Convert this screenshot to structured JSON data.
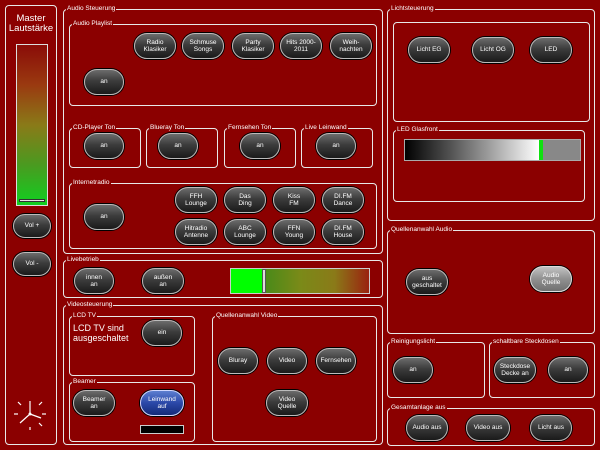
{
  "master": {
    "title": "Master\nLautstärke",
    "vol_plus": "Vol +",
    "vol_minus": "Vol -",
    "level_percent": 3
  },
  "audio": {
    "title": "Audio Steuerung",
    "playlist": {
      "title": "Audio Playlist",
      "on": "an",
      "items": [
        "Radio\nKlasiker",
        "Schmuse\nSongs",
        "Party\nKlasiker",
        "Hits 2000-\n2011",
        "Weih-\nnachten"
      ]
    },
    "cd": {
      "title": "CD-Player Ton",
      "on": "an"
    },
    "bluray": {
      "title": "Blueray Ton",
      "on": "an"
    },
    "fernsehen": {
      "title": "Fernsehen Ton",
      "on": "an"
    },
    "leinwand": {
      "title": "Live Leinwand",
      "on": "an"
    },
    "internetradio": {
      "title": "Internetradio",
      "on": "an",
      "stations": [
        "FFH\nLounge",
        "Das\nDing",
        "Kiss\nFM",
        "DI.FM\nDance",
        "Hitradio\nAntenne",
        "ABC\nLounge",
        "FFN\nYoung",
        "DI.FM\nHouse"
      ]
    }
  },
  "livebetrieb": {
    "title": "Livebetrieb",
    "innen": "innen\nan",
    "aussen": "außen\nan",
    "level_percent": 22
  },
  "video": {
    "title": "Videosteuerung",
    "lcd": {
      "title": "LCD TV",
      "status": "LCD TV sind\nausgeschaltet",
      "on": "ein"
    },
    "beamer": {
      "title": "Beamer",
      "beamer_on": "Beamer\nan",
      "leinwand_auf": "Leinwand\nauf"
    },
    "quelle": {
      "title": "Quellenanwahl Video",
      "items": [
        "Bluray",
        "Video",
        "Fernsehen",
        "Video\nQuelle"
      ]
    }
  },
  "licht": {
    "title": "Lichtsteuerung",
    "buttons": [
      "Licht EG",
      "Licht OG",
      "LED"
    ],
    "led": {
      "title": "LED Glasfront",
      "level_percent": 75
    }
  },
  "quellen_audio": {
    "title": "Quellenanwahl Audio",
    "aus": "aus\ngeschaltet",
    "audio_quelle": "Audio\nQuelle"
  },
  "reinigung": {
    "title": "Reinigungslicht",
    "on": "an"
  },
  "steckdosen": {
    "title": "schaltbare Steckdosen",
    "decke": "Steckdose\nDecke an",
    "on": "an"
  },
  "gesamt": {
    "title": "Gesamtanlage aus",
    "buttons": [
      "Audio aus",
      "Video aus",
      "Licht aus"
    ]
  },
  "colors": {
    "background": "#8b0000",
    "active_button": "#2b48a8",
    "meter_green": "#00ff00"
  }
}
